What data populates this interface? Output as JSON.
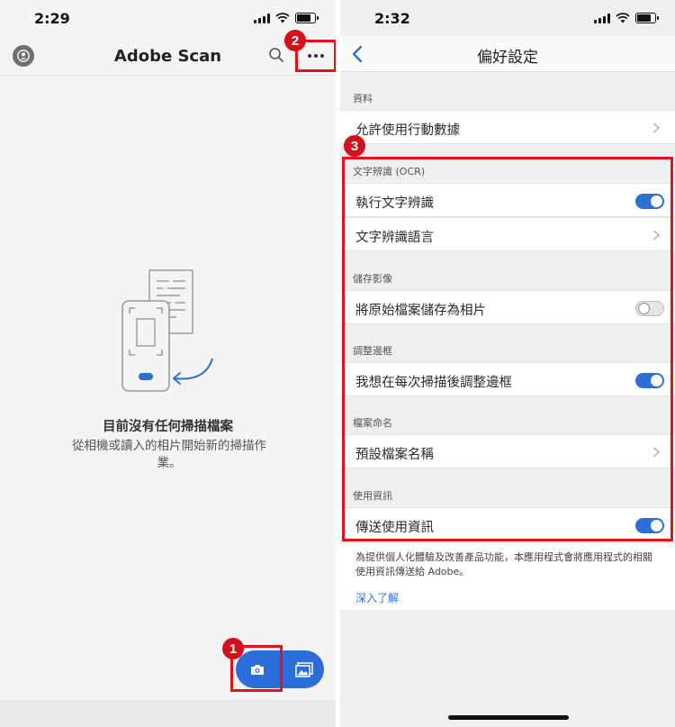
{
  "left_screen": {
    "status_time": "2:29",
    "app_title": "Adobe Scan",
    "empty_title": "目前沒有任何掃描檔案",
    "empty_desc": "從相機或讀入的相片開始新的掃描作業。",
    "badges": {
      "camera": "1",
      "more": "2"
    },
    "icons": [
      "avatar-icon",
      "search-icon",
      "more-icon",
      "camera-icon",
      "gallery-icon"
    ]
  },
  "right_screen": {
    "status_time": "2:32",
    "nav_title": "偏好設定",
    "badge": "3",
    "sections": [
      {
        "label": "資料",
        "rows": [
          {
            "label": "允許使用行動數據",
            "control": "chevron"
          }
        ]
      },
      {
        "label": "文字辨識 (OCR)",
        "rows": [
          {
            "label": "執行文字辨識",
            "control": "toggle",
            "on": true
          },
          {
            "label": "文字辨識語言",
            "control": "chevron"
          }
        ]
      },
      {
        "label": "儲存影像",
        "rows": [
          {
            "label": "將原始檔案儲存為相片",
            "control": "toggle",
            "on": false
          }
        ]
      },
      {
        "label": "調整邊框",
        "rows": [
          {
            "label": "我想在每次掃描後調整邊框",
            "control": "toggle",
            "on": true
          }
        ]
      },
      {
        "label": "檔案命名",
        "rows": [
          {
            "label": "預設檔案名稱",
            "control": "chevron"
          }
        ]
      },
      {
        "label": "使用資訊",
        "rows": [
          {
            "label": "傳送使用資訊",
            "control": "toggle",
            "on": true
          }
        ]
      }
    ],
    "footer_text": "為提供個人化體驗及改善產品功能，本應用程式會將應用程式的相關使用資訊傳送給 Adobe。",
    "learn_more": "深入了解"
  },
  "colors": {
    "accent": "#2f6ed3",
    "highlight": "#e3131b",
    "badge": "#d4111a"
  }
}
